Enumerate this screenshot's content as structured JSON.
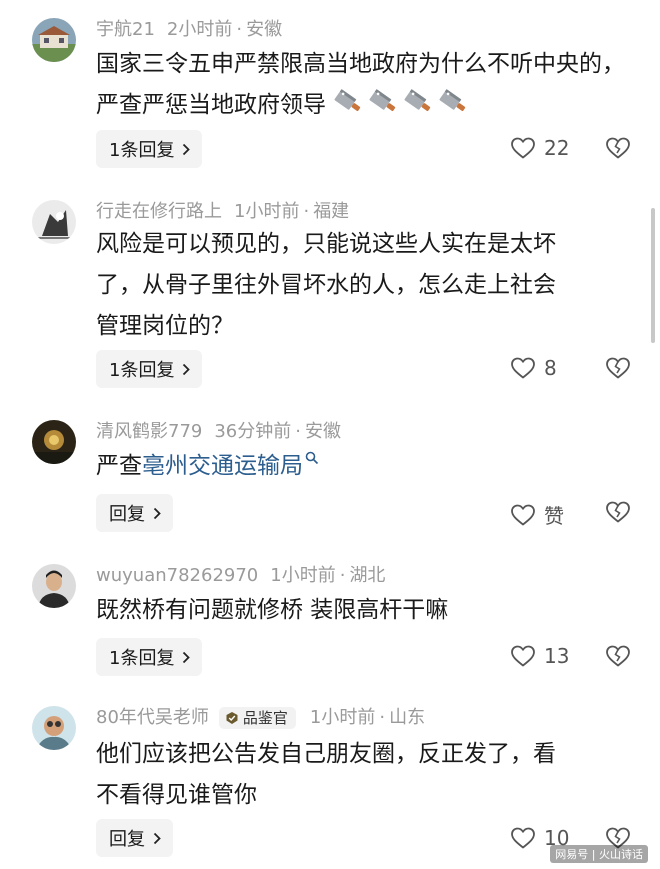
{
  "comments": [
    {
      "username": "宇航21",
      "time": "2小时前",
      "location": "安徽",
      "text": "国家三令五申严禁限高当地政府为什么不听中央的，严查严惩当地政府领导",
      "emoji_icons": [
        "cleaver-icon",
        "cleaver-icon",
        "cleaver-icon",
        "cleaver-icon"
      ],
      "reply_label": "1条回复",
      "like_count": "22"
    },
    {
      "username": "行走在修行路上",
      "time": "1小时前",
      "location": "福建",
      "text_lines": [
        "风险是可以预见的，只能说这些人实在是太坏",
        "了，从骨子里往外冒坏水的人，怎么走上社会",
        "管理岗位的？"
      ],
      "reply_label": "1条回复",
      "like_count": "8"
    },
    {
      "username": "清风鹤影779",
      "time": "36分钟前",
      "location": "安徽",
      "text_prefix": "严查",
      "text_link": "亳州交通运输局",
      "reply_label": "回复",
      "like_count": "赞"
    },
    {
      "username": "wuyuan78262970",
      "time": "1小时前",
      "location": "湖北",
      "text": "既然桥有问题就修桥 装限高杆干嘛",
      "reply_label": "1条回复",
      "like_count": "13"
    },
    {
      "username": "80年代吴老师",
      "badge": "品鉴官",
      "time": "1小时前",
      "location": "山东",
      "text_lines": [
        "他们应该把公告发自己朋友圈，反正发了，看",
        "不看得见谁管你"
      ],
      "reply_label": "回复",
      "like_count": "10"
    }
  ],
  "separator": "·",
  "watermark": "网易号 | 火山诗话",
  "colors": {
    "meta": "#9a9a9a",
    "text": "#1a1a1a",
    "link": "#2b5d8e",
    "button_bg": "#f3f3f3"
  }
}
